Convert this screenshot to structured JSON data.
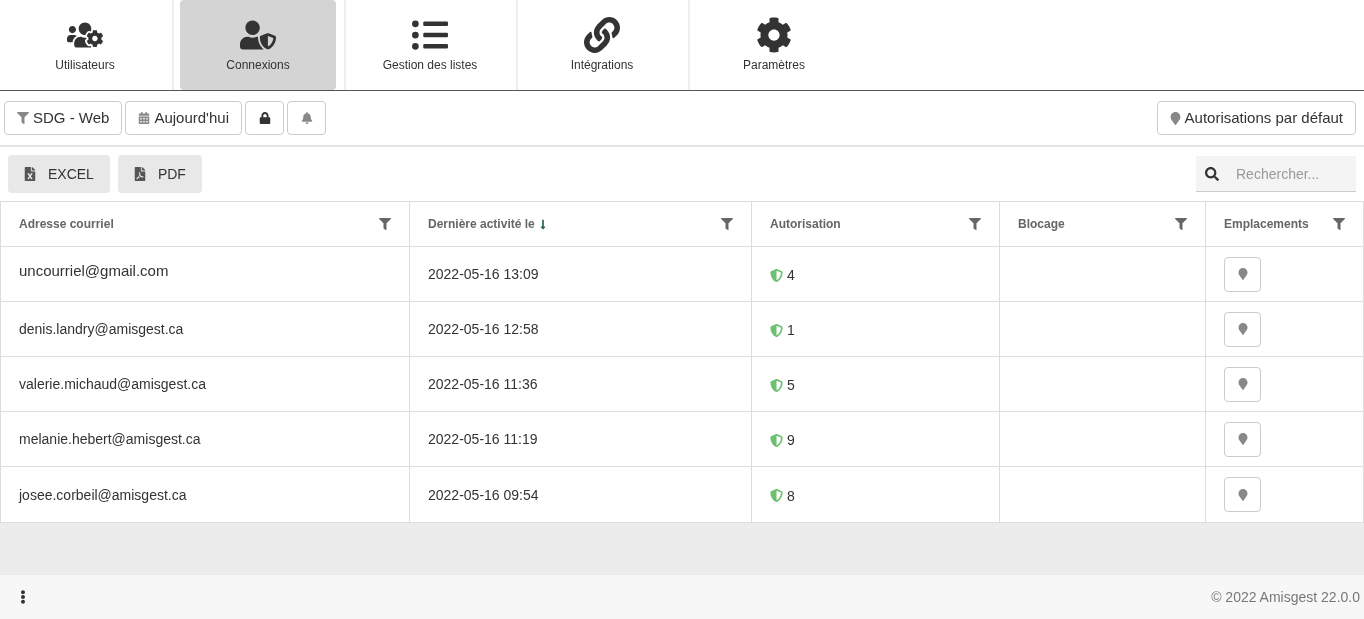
{
  "tabs": [
    {
      "kind": "users",
      "label": "Utilisateurs",
      "selected": false
    },
    {
      "kind": "connections",
      "label": "Connexions",
      "selected": true
    },
    {
      "kind": "lists",
      "label": "Gestion des listes",
      "selected": false
    },
    {
      "kind": "integrations",
      "label": "Intégrations",
      "selected": false
    },
    {
      "kind": "settings",
      "label": "Paramètres",
      "selected": false
    }
  ],
  "toolbar": [
    {
      "kind": "filter",
      "label": "SDG - Web"
    },
    {
      "kind": "calendar",
      "label": "Aujourd'hui"
    },
    {
      "kind": "lock"
    },
    {
      "kind": "bell"
    }
  ],
  "default_permissions_button": "Autorisations par défaut",
  "export_buttons": [
    {
      "kind": "excel",
      "label": "EXCEL"
    },
    {
      "kind": "pdf",
      "label": "PDF"
    }
  ],
  "search": {
    "placeholder": "Rechercher..."
  },
  "table": {
    "columns": [
      {
        "label": "Adresse courriel",
        "sorted": false
      },
      {
        "label": "Dernière activité le",
        "sorted": true
      },
      {
        "label": "Autorisation",
        "sorted": false
      },
      {
        "label": "Blocage",
        "sorted": false
      },
      {
        "label": "Emplacements",
        "sorted": false
      }
    ],
    "rows": [
      {
        "email": "uncourriel@gmail.com",
        "last_activity": "2022-05-16 13:09",
        "authorization": "4"
      },
      {
        "email": "denis.landry@amisgest.ca",
        "last_activity": "2022-05-16 12:58",
        "authorization": "1"
      },
      {
        "email": "valerie.michaud@amisgest.ca",
        "last_activity": "2022-05-16 11:36",
        "authorization": "5"
      },
      {
        "email": "melanie.hebert@amisgest.ca",
        "last_activity": "2022-05-16 11:19",
        "authorization": "9"
      },
      {
        "email": "josee.corbeil@amisgest.ca",
        "last_activity": "2022-05-16 09:54",
        "authorization": "8"
      }
    ]
  },
  "footer": {
    "copyright": "© 2022 Amisgest 22.0.0"
  }
}
